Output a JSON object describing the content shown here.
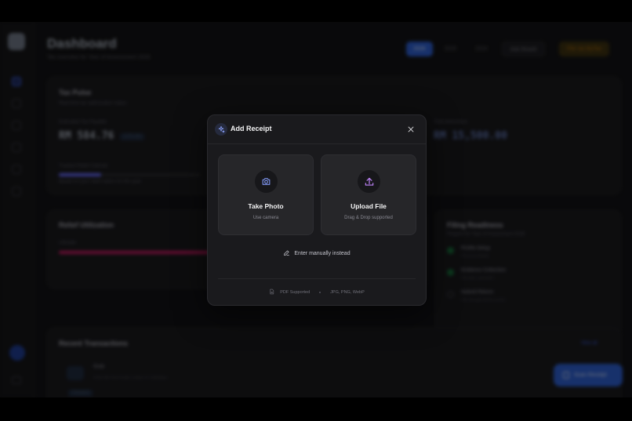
{
  "dashboard": {
    "title": "Dashboard",
    "subtitle": "Tax overview for Year of Assessment 2026",
    "tabs": [
      "2026",
      "2025",
      "2024"
    ],
    "ask_button": "Ask Roseli",
    "file_button": "File via MyTax"
  },
  "tax_pulse": {
    "title": "Tax Pulse",
    "subtitle": "Real-time tax optimization status",
    "estimated_label": "Estimated Tax Payable",
    "estimated_value": "RM 584.76",
    "estimated_badge": "3.2% rate",
    "total_relief_label": "Total deductions",
    "total_relief_value": "RM 15,500.00",
    "progress_label": "Tracked Relief Claimed",
    "progress_note": "Based on your relief claims for this year",
    "progress_fraction": 0.3
  },
  "relief": {
    "title": "Relief Utilization",
    "item_label": "Lifestyle",
    "progress_fraction": 0.55
  },
  "filing": {
    "title": "Filing Readiness",
    "subtitle": "Prepare for Year of Assessment 2026",
    "items": [
      {
        "title": "Profile Setup",
        "sub": "Personal details",
        "done": true
      },
      {
        "title": "Evidence Collection",
        "sub": "Receipts uploaded",
        "done": true
      },
      {
        "title": "Submit Return",
        "sub": "File through MyTax portal",
        "done": false
      }
    ]
  },
  "transactions": {
    "title": "Recent Transactions",
    "view_all": "View all",
    "row_title": "Grab",
    "row_sub": "Grab ride from Kuala Lumpur to Cyberjaya",
    "row_chip": "Transport"
  },
  "fab": {
    "label": "Scan Receipt"
  },
  "modal": {
    "title": "Add Receipt",
    "photo_title": "Take Photo",
    "photo_sub": "Use camera",
    "upload_title": "Upload File",
    "upload_sub": "Drag & Drop supported",
    "manual_label": "Enter manually instead",
    "foot_pdf": "PDF Supported",
    "foot_formats": "JPG, PNG, WebP"
  },
  "colors": {
    "accent": "#2b59c3",
    "modal_bg": "#1a1a1d",
    "option_bg": "#262629",
    "sparkle": "#8ea5ff",
    "relief_bar": "#be185d"
  },
  "icons": [
    "sparkle-icon",
    "close-icon",
    "camera-icon",
    "upload-icon",
    "pencil-icon",
    "document-icon"
  ]
}
